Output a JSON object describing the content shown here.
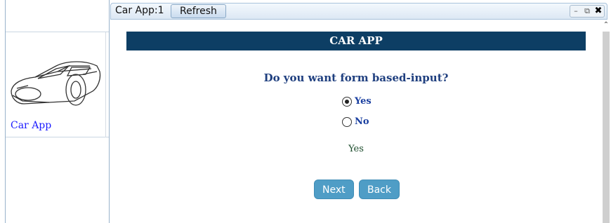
{
  "window": {
    "title": "Car App:1",
    "refresh_label": "Refresh",
    "controls": {
      "minimize": "–",
      "restore": "⧉",
      "close": "✖"
    }
  },
  "sidebar": {
    "apps": [
      {
        "label": "Car App",
        "icon": "car-icon"
      }
    ]
  },
  "main": {
    "header": "CAR APP",
    "question": "Do you want form based-input?",
    "options": [
      {
        "label": "Yes",
        "checked": true
      },
      {
        "label": "No",
        "checked": false
      }
    ],
    "selected_value": "Yes",
    "buttons": {
      "next": "Next",
      "back": "Back"
    }
  },
  "colors": {
    "header_bg": "#0d3e64",
    "question_text": "#1f3f7f",
    "button_bg": "#4f9dc6"
  }
}
